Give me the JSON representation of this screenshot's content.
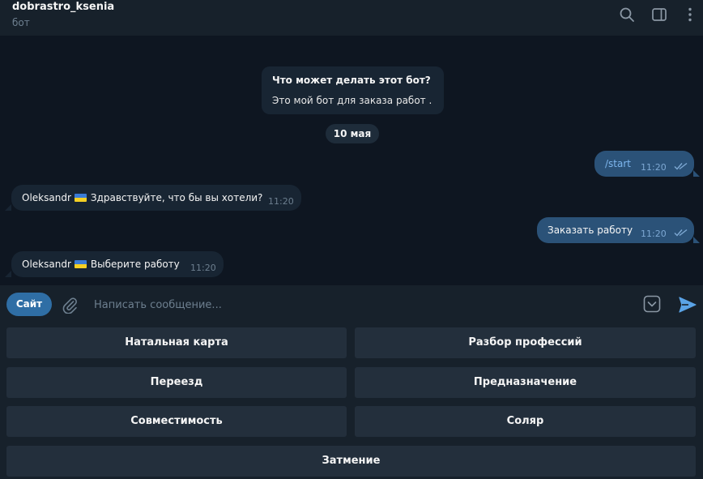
{
  "header": {
    "title": "dobrastro_ksenia",
    "subtitle": "бот",
    "icons": [
      "search-icon",
      "sidebar-toggle-icon",
      "more-icon"
    ]
  },
  "chat": {
    "intro": {
      "title": "Что может делать этот бот?",
      "text": "Это мой бот для заказа работ ."
    },
    "date": "10 мая",
    "messages": [
      {
        "direction": "out",
        "text": "/start",
        "time": "11:20",
        "read": true
      },
      {
        "direction": "in",
        "sender": "Oleksandr",
        "text": "Здравствуйте, что бы вы хотели?",
        "time": "11:20"
      },
      {
        "direction": "out",
        "text": "Заказать работу",
        "time": "11:20",
        "read": true
      },
      {
        "direction": "in",
        "sender": "Oleksandr",
        "text": "Выберите работу",
        "time": "11:20"
      }
    ]
  },
  "input": {
    "site_button": "Сайт",
    "placeholder": "Написать сообщение..."
  },
  "keyboard": {
    "buttons": [
      "Натальная карта",
      "Разбор профессий",
      "Переезд",
      "Предназначение",
      "Совместимость",
      "Соляр",
      "Затмение"
    ]
  },
  "colors": {
    "background": "#0e1621",
    "panel": "#17212b",
    "incoming_bubble": "#182533",
    "outgoing_bubble": "#2b5278",
    "accent": "#2f6ea5",
    "keyboard_button": "#232f3c"
  }
}
